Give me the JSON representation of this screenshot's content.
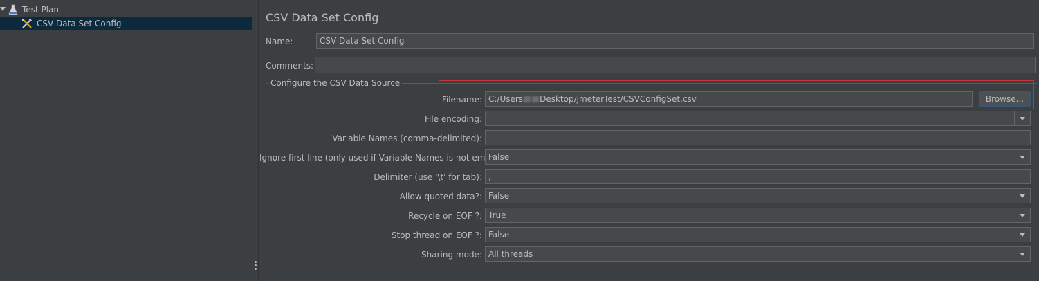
{
  "tree": {
    "root_label": "Test Plan",
    "child_label": "CSV Data Set Config"
  },
  "panel": {
    "title": "CSV Data Set Config",
    "name_label": "Name:",
    "name_value": "CSV Data Set Config",
    "comments_label": "Comments:",
    "comments_value": "",
    "group_title": "Configure the CSV Data Source",
    "filename_label": "Filename:",
    "filename_prefix": "C:/Users",
    "filename_suffix": "Desktop/jmeterTest/CSVConfigSet.csv",
    "browse_label": "Browse...",
    "file_encoding_label": "File encoding:",
    "file_encoding_value": "",
    "variable_names_label": "Variable Names (comma-delimited):",
    "variable_names_value": "",
    "ignore_first_line_label": "Ignore first line (only used if Variable Names is not empty):",
    "ignore_first_line_value": "False",
    "delimiter_label": "Delimiter (use '\\t' for tab):",
    "delimiter_value": ",",
    "allow_quoted_label": "Allow quoted data?:",
    "allow_quoted_value": "False",
    "recycle_label": "Recycle on EOF ?:",
    "recycle_value": "True",
    "stop_thread_label": "Stop thread on EOF ?:",
    "stop_thread_value": "False",
    "sharing_label": "Sharing mode:",
    "sharing_value": "All threads"
  },
  "colors": {
    "background": "#3c3f41",
    "field": "#45494a",
    "selection": "#0d293e",
    "highlight_border": "#c8323c",
    "focus_border": "#365880"
  }
}
